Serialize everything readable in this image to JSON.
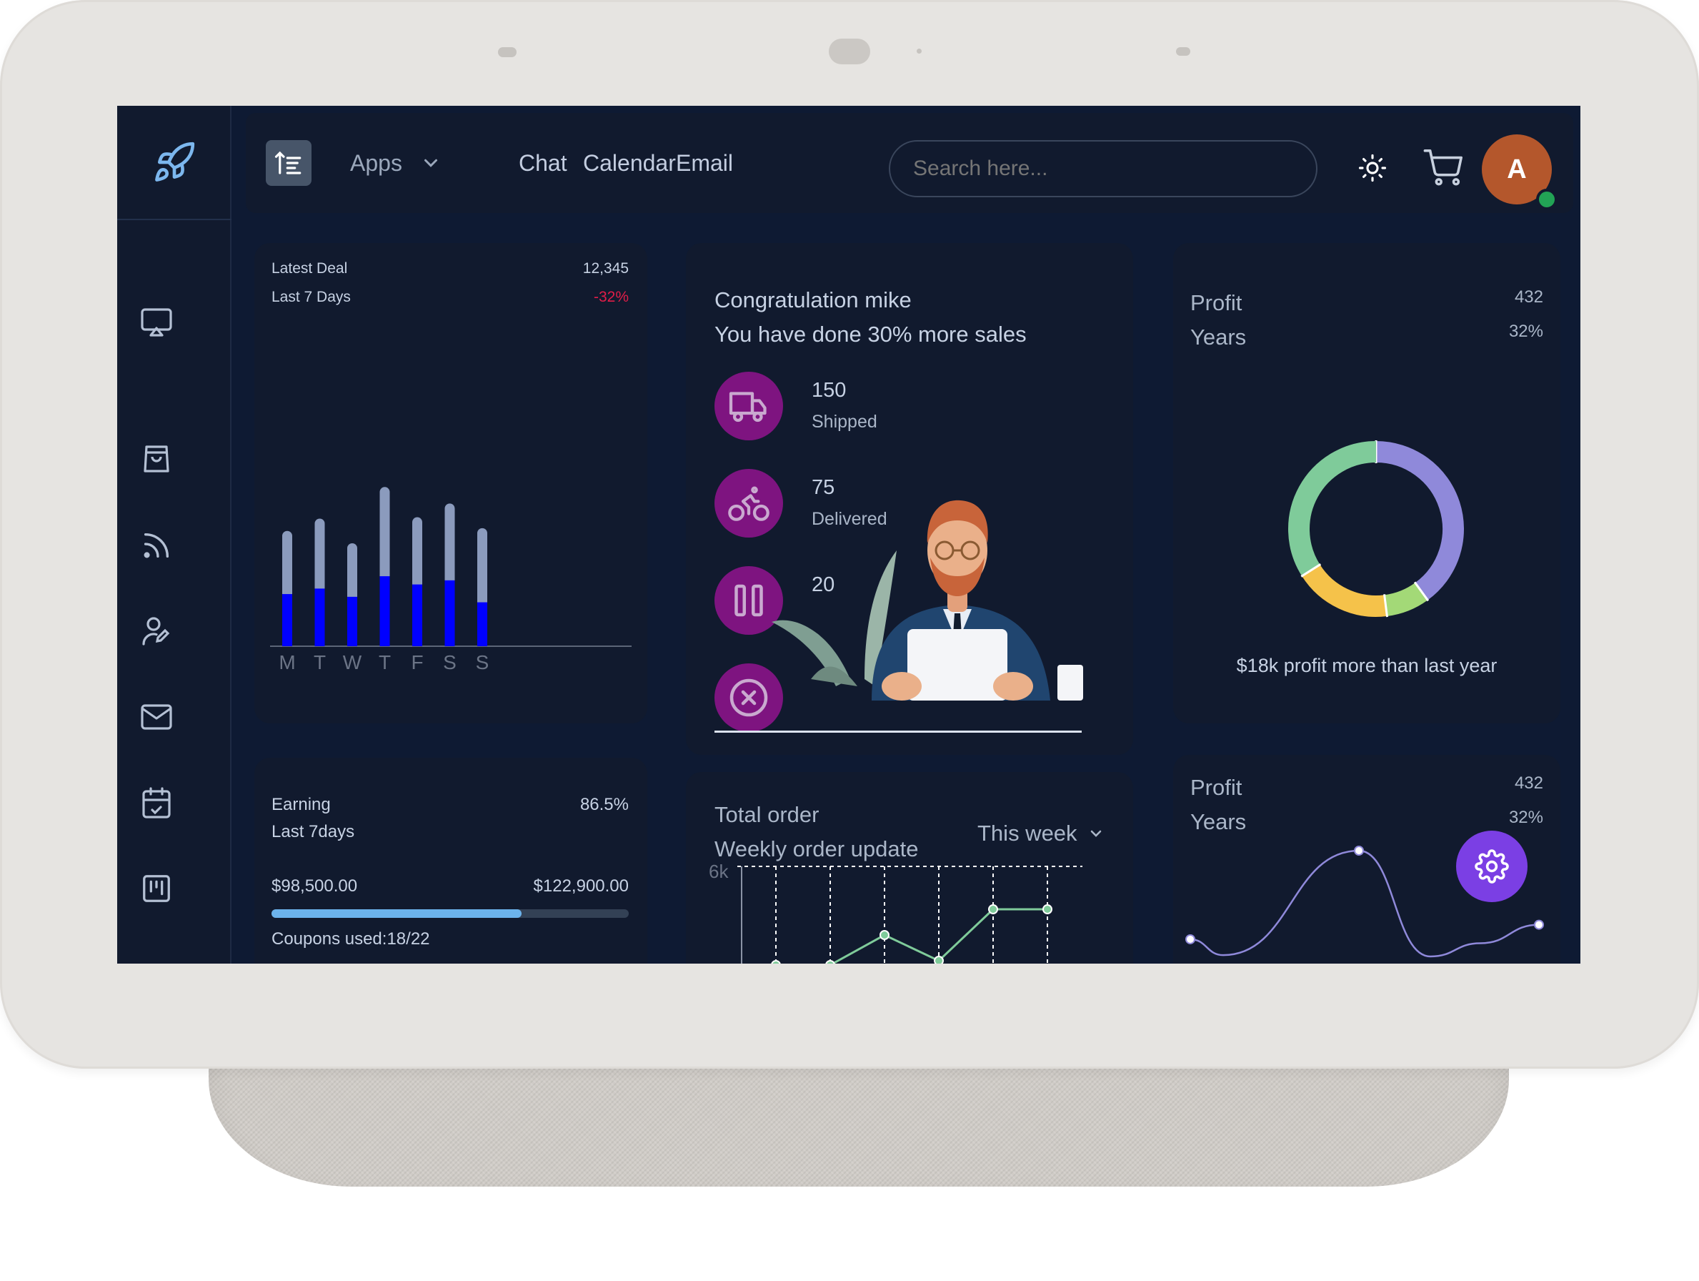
{
  "header": {
    "nav": {
      "apps": "Apps",
      "chat": "Chat",
      "calendar": "Calendar",
      "email": "Email"
    },
    "search_placeholder": "Search here...",
    "avatar_initial": "A"
  },
  "latest_deal": {
    "title": "Latest Deal",
    "value": "12,345",
    "subtitle": "Last 7 Days",
    "change": "-32%",
    "change_color": "#e11d48",
    "chart_data": {
      "type": "bar",
      "categories": [
        "M",
        "T",
        "W",
        "T",
        "F",
        "S",
        "S"
      ],
      "series": [
        {
          "values": [
            38,
            42,
            36,
            51,
            45,
            48,
            32
          ]
        },
        {
          "values": [
            84,
            93,
            75,
            116,
            94,
            104,
            86
          ]
        }
      ],
      "colors": [
        "#0000ff",
        "#8b9bbd"
      ]
    }
  },
  "congrats": {
    "title": "Congratulation mike",
    "subtitle": "You have done 30% more sales",
    "stats": [
      {
        "value": "150",
        "label": "Shipped",
        "icon": "truck-icon"
      },
      {
        "value": "75",
        "label": "Delivered",
        "icon": "bicycle-icon"
      },
      {
        "value": "20",
        "label": "",
        "icon": "pause-icon"
      },
      {
        "value": "",
        "label": "",
        "icon": "cancel-icon"
      }
    ]
  },
  "profit_donut": {
    "title": "Profit",
    "value": "432",
    "subtitle": "Years",
    "percent": "32%",
    "footer": "$18k profit more than last year",
    "chart_data": {
      "type": "pie",
      "values": [
        40,
        8,
        18,
        34
      ],
      "colors": [
        "#8f89da",
        "#a3d977",
        "#f5c24a",
        "#7fcb9a"
      ]
    }
  },
  "earning": {
    "title": "Earning",
    "percent": "86.5%",
    "subtitle": "Last 7days",
    "current": "$98,500.00",
    "target": "$122,900.00",
    "progress": 0.7,
    "coupons": "Coupons used:18/22"
  },
  "total_order": {
    "title": "Total order",
    "subtitle": "Weekly order update",
    "period": "This week",
    "chart_data": {
      "type": "line",
      "ytick": "6k",
      "series": [
        {
          "values": [
            2.1,
            2.1,
            2.8,
            2.2,
            3.4,
            3.4
          ]
        }
      ],
      "color": "#7fcb9a"
    }
  },
  "profit_line": {
    "title": "Profit",
    "value": "432",
    "subtitle": "Years",
    "percent": "32%",
    "chart_data": {
      "type": "line",
      "series": [
        {
          "values": [
            1.3,
            0.1,
            8.0,
            0.0,
            1.0,
            2.4
          ]
        }
      ],
      "color": "#8f89da"
    }
  },
  "fab_icon": "settings-icon"
}
